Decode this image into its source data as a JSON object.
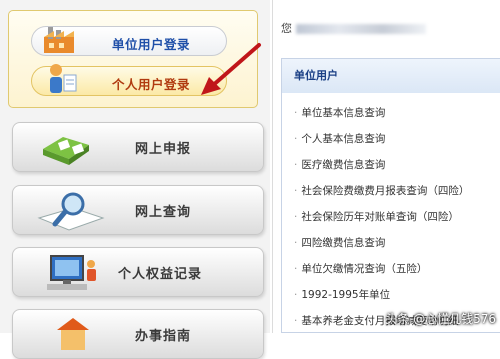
{
  "login_panel": {
    "unit_login_label": "单位用户登录",
    "personal_login_label": "个人用户登录"
  },
  "nav": {
    "online_report": "网上申报",
    "online_query": "网上查询",
    "rights_record": "个人权益记录",
    "partial_bottom": "办事指南"
  },
  "header": {
    "welcome_prefix": "您"
  },
  "unit_panel": {
    "title": "单位用户",
    "items": [
      "单位基本信息查询",
      "个人基本信息查询",
      "医疗缴费信息查询",
      "社会保险费缴费月报表查询（四险）",
      "社会保险历年对账单查询（四险）",
      "四险缴费信息查询",
      "单位欠缴情况查询（五险）",
      "1992-1995年单位",
      "基本养老金支付月报增减变动明细"
    ]
  },
  "watermark": "头条 @心懂几钱576",
  "colors": {
    "accent_blue": "#1f4fa8",
    "arrow_red": "#c0161a",
    "panel_title_blue": "#1a3f85"
  }
}
